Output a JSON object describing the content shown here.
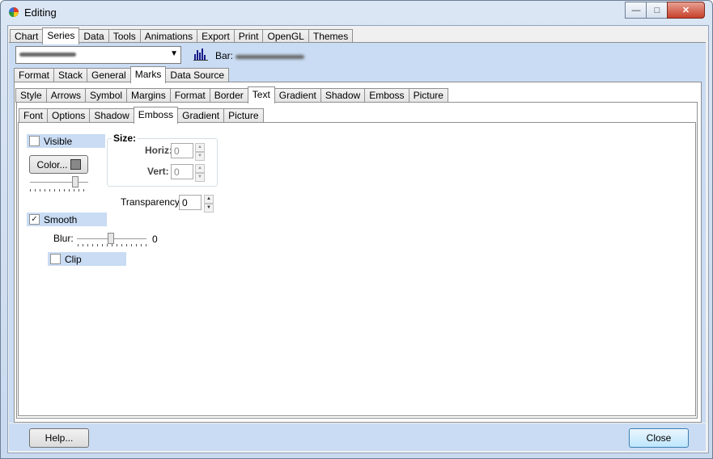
{
  "window": {
    "title": "Editing",
    "caption_min": "—",
    "caption_max": "□",
    "caption_close": "✕"
  },
  "top_tabs": [
    "Chart",
    "Series",
    "Data",
    "Tools",
    "Animations",
    "Export",
    "Print",
    "OpenGL",
    "Themes"
  ],
  "series_bar": {
    "bar_label": "Bar:"
  },
  "series_tabs": [
    "Format",
    "Stack",
    "General",
    "Marks",
    "Data Source"
  ],
  "marks_tabs": [
    "Style",
    "Arrows",
    "Symbol",
    "Margins",
    "Format",
    "Border",
    "Text",
    "Gradient",
    "Shadow",
    "Emboss",
    "Picture"
  ],
  "text_tabs": [
    "Font",
    "Options",
    "Shadow",
    "Emboss",
    "Gradient",
    "Picture"
  ],
  "emboss": {
    "visible_label": "Visible",
    "visible_checked": false,
    "color_button": "Color...",
    "size_label": "Size:",
    "horiz_label": "Horiz:",
    "horiz_value": "0",
    "vert_label": "Vert:",
    "vert_value": "0",
    "transparency_label": "Transparency:",
    "transparency_value": "0",
    "smooth_label": "Smooth",
    "smooth_checked": true,
    "smooth_mark": "✓",
    "blur_label": "Blur:",
    "blur_value": "0",
    "clip_label": "Clip",
    "clip_checked": false
  },
  "footer": {
    "help_button": "Help...",
    "close_button": "Close"
  }
}
